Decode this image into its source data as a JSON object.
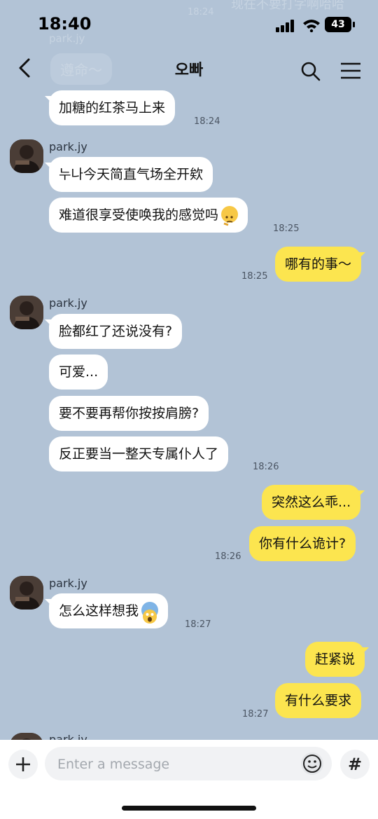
{
  "status_bar": {
    "time": "18:40",
    "battery": "43"
  },
  "header": {
    "title": "오빠"
  },
  "messages": [
    {
      "kind": "text",
      "from": "them",
      "text": "加糖的红茶马上来",
      "time": "18:24"
    },
    {
      "kind": "sender",
      "name": "park.jy"
    },
    {
      "kind": "text",
      "from": "them",
      "text": "누나今天简直气场全开欸"
    },
    {
      "kind": "text",
      "from": "them",
      "text": "难道很享受使唤我的感觉吗",
      "emoji": "thinking-face",
      "time": "18:25"
    },
    {
      "kind": "text",
      "from": "me",
      "text": "哪有的事～",
      "time": "18:25"
    },
    {
      "kind": "sender",
      "name": "park.jy"
    },
    {
      "kind": "text",
      "from": "them",
      "text": "脸都红了还说没有?"
    },
    {
      "kind": "text",
      "from": "them",
      "text": "可爱..."
    },
    {
      "kind": "text",
      "from": "them",
      "text": "要不要再帮你按按肩膀?"
    },
    {
      "kind": "text",
      "from": "them",
      "text": "反正要当一整天专属仆人了",
      "time": "18:26"
    },
    {
      "kind": "text",
      "from": "me",
      "text": "突然这么乖..."
    },
    {
      "kind": "text",
      "from": "me",
      "text": "你有什么诡计?",
      "time": "18:26"
    },
    {
      "kind": "sender",
      "name": "park.jy"
    },
    {
      "kind": "text",
      "from": "them",
      "text": "怎么这样想我",
      "emoji": "screaming-face",
      "time": "18:27"
    },
    {
      "kind": "text",
      "from": "me",
      "text": "赶紧说"
    },
    {
      "kind": "text",
      "from": "me",
      "text": "有什么要求",
      "time": "18:27"
    },
    {
      "kind": "sender",
      "name": "park.jy"
    }
  ],
  "ghost": {
    "top_text": "现在不要打字啊哈哈",
    "bubble_text": "遵命～",
    "sender": "park.jy",
    "time": "18:24"
  },
  "input": {
    "placeholder": "Enter a message",
    "value": ""
  },
  "colors": {
    "background": "#b2c3d6",
    "my_bubble": "#fce54f",
    "their_bubble": "#ffffff"
  },
  "icons": [
    "back-arrow-icon",
    "search-icon",
    "menu-icon",
    "plus-icon",
    "emoji-icon",
    "hashtag-icon"
  ]
}
